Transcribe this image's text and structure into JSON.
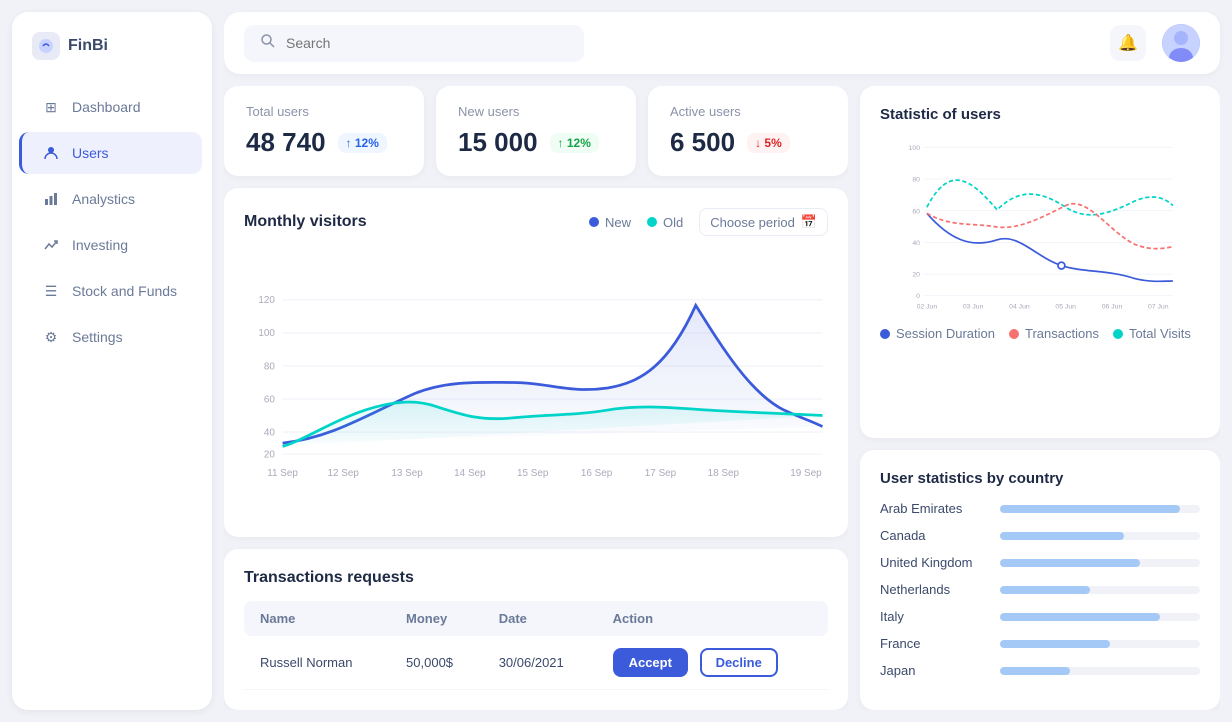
{
  "app": {
    "name": "FinBi"
  },
  "sidebar": {
    "items": [
      {
        "id": "dashboard",
        "label": "Dashboard",
        "icon": "⊞",
        "active": false
      },
      {
        "id": "users",
        "label": "Users",
        "icon": "👤",
        "active": true
      },
      {
        "id": "analytics",
        "label": "Analystics",
        "icon": "📊",
        "active": false
      },
      {
        "id": "investing",
        "label": "Investing",
        "icon": "📈",
        "active": false
      },
      {
        "id": "stock",
        "label": "Stock and Funds",
        "icon": "☰",
        "active": false
      },
      {
        "id": "settings",
        "label": "Settings",
        "icon": "⚙",
        "active": false
      }
    ]
  },
  "header": {
    "search_placeholder": "Search"
  },
  "stats": [
    {
      "id": "total-users",
      "label": "Total users",
      "value": "48 740",
      "badge": "↑ 12%",
      "badge_type": "up"
    },
    {
      "id": "new-users",
      "label": "New users",
      "value": "15 000",
      "badge": "↑ 12%",
      "badge_type": "up-green"
    },
    {
      "id": "active-users",
      "label": "Active users",
      "value": "6 500",
      "badge": "↓ 5%",
      "badge_type": "down"
    }
  ],
  "monthly_chart": {
    "title": "Monthly visitors",
    "legend": [
      {
        "label": "New",
        "color": "#3b5bdb"
      },
      {
        "label": "Old",
        "color": "#00d4c8"
      }
    ],
    "choose_period": "Choose period",
    "x_labels": [
      "11 Sep",
      "12 Sep",
      "13 Sep",
      "14 Sep",
      "15 Sep",
      "16 Sep",
      "17 Sep",
      "18 Sep",
      "19 Sep"
    ],
    "y_labels": [
      "20",
      "40",
      "60",
      "80",
      "100",
      "120"
    ]
  },
  "statistic_chart": {
    "title": "Statistic of users",
    "y_labels": [
      "0",
      "20",
      "40",
      "60",
      "80",
      "100"
    ],
    "x_labels": [
      "02 Jun",
      "03 Jun",
      "04 Jun",
      "05 Jun",
      "06 Jun",
      "07 Jun"
    ],
    "legend": [
      {
        "label": "Session Duration",
        "color": "#3b5bdb"
      },
      {
        "label": "Transactions",
        "color": "#f87171"
      },
      {
        "label": "Total Visits",
        "color": "#00d4c8"
      }
    ]
  },
  "transactions": {
    "title": "Transactions requests",
    "columns": [
      "Name",
      "Money",
      "Date",
      "Action"
    ],
    "rows": [
      {
        "name": "Russell Norman",
        "money": "50,000$",
        "date": "30/06/2021"
      }
    ],
    "btn_accept": "Accept",
    "btn_decline": "Decline"
  },
  "country_stats": {
    "title": "User statistics by country",
    "countries": [
      {
        "name": "Arab Emirates",
        "pct": 90
      },
      {
        "name": "Canada",
        "pct": 62
      },
      {
        "name": "United Kingdom",
        "pct": 70
      },
      {
        "name": "Netherlands",
        "pct": 45
      },
      {
        "name": "Italy",
        "pct": 80
      },
      {
        "name": "France",
        "pct": 55
      },
      {
        "name": "Japan",
        "pct": 35
      }
    ]
  }
}
